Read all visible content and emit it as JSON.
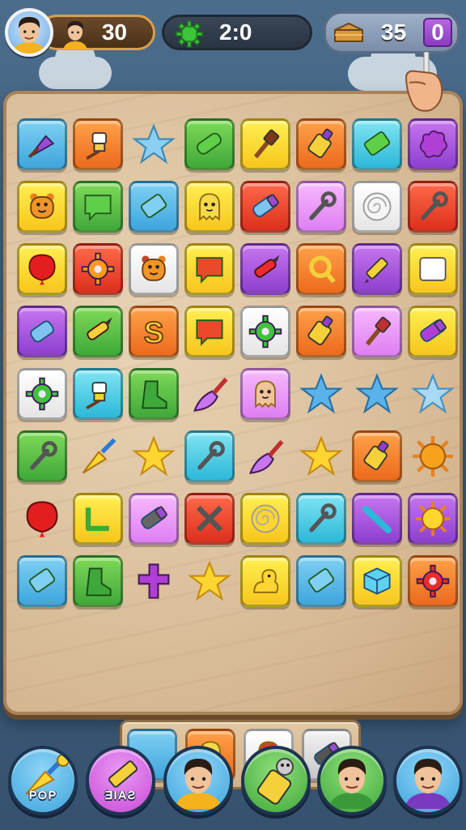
{
  "hud": {
    "score": "30",
    "timer": "2:0",
    "coins": "35",
    "coins_box": "0",
    "icons": {
      "avatar": "player-avatar",
      "timer": "gear-icon",
      "coins": "chest-icon"
    }
  },
  "board": {
    "rows": [
      [
        "blue:wedge",
        "orange:brush",
        "free:star",
        "green:log",
        "yellow:hammer",
        "orange:glue",
        "cyan:eraser",
        "purple:splat"
      ],
      [
        "yellow:monster",
        "green:chat",
        "blue:eraser",
        "yellow:ghost",
        "red:tube",
        "pink:wrench",
        "white:swirl",
        "red:wrench"
      ],
      [
        "yellow:balloon",
        "red:gear",
        "white:monster",
        "yellow:chat",
        "purple:marker",
        "orange:ring",
        "purple:pencil",
        "yellow:square"
      ],
      [
        "purple:bottle",
        "green:marker",
        "orange:letter-s",
        "yellow:chat",
        "white:gear",
        "orange:glue",
        "pink:hammer",
        "yellow:tube"
      ],
      [
        "white:gear",
        "cyan:brush",
        "green:boot",
        "free:paintbrush",
        "pink:ghost",
        "free:star-blue",
        "free:star-blue",
        "free:star-light"
      ],
      [
        "green:wrench",
        "free:broom",
        "free:star-gold",
        "cyan:wrench",
        "free:paintbrush",
        "free:star-gold",
        "orange:glue",
        "free:sun"
      ],
      [
        "free:balloon",
        "yellow:angle",
        "pink:tube",
        "red:cross",
        "yellow:swirl",
        "cyan:wrench",
        "purple:stick",
        "purple:sun"
      ],
      [
        "blue:eraser",
        "green:boot",
        "free:cross-purple",
        "free:star-gold",
        "yellow:duck",
        "blue:eraser",
        "yellow:cube",
        "orange:gear"
      ]
    ]
  },
  "tray": [
    "blue:empty",
    "orange:ghost",
    "white:ghost",
    "gray:tube"
  ],
  "buttons": [
    {
      "label": "POP",
      "icon": "broom-icon"
    },
    {
      "label": "ƎIAƧ",
      "icon": "pencil-icon"
    },
    {
      "label": "",
      "icon": "friend-avatar"
    },
    {
      "label": "",
      "icon": "glue-icon"
    },
    {
      "label": "",
      "icon": "friend-avatar"
    },
    {
      "label": "",
      "icon": "friend-avatar"
    }
  ]
}
